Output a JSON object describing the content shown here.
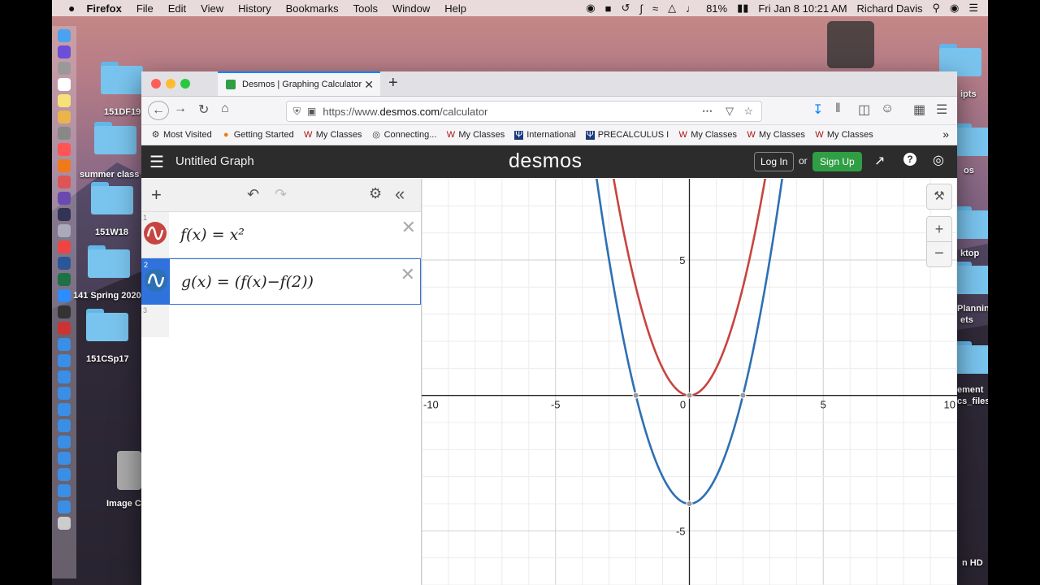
{
  "menubar": {
    "app": "Firefox",
    "items": [
      "File",
      "Edit",
      "View",
      "History",
      "Bookmarks",
      "Tools",
      "Window",
      "Help"
    ],
    "battery": "81%",
    "clock": "Fri Jan 8  10:21 AM",
    "user": "Richard Davis"
  },
  "desktop": {
    "labels": [
      "151DF19",
      "summer class",
      "151W18",
      "141 Spring 2020",
      "151CSp17",
      "Image C",
      "ipts",
      "os",
      "ktop",
      "Plannin",
      "ets",
      "ement",
      "cs_files",
      "n HD"
    ]
  },
  "browser": {
    "tab_title": "Desmos | Graphing Calculator",
    "url_prefix": "https://www.",
    "url_domain": "desmos.com",
    "url_path": "/calculator",
    "bookmarks": [
      "Most Visited",
      "Getting Started",
      "My Classes",
      "Connecting...",
      "My Classes",
      "International",
      "PRECALCULUS I",
      "My Classes",
      "My Classes",
      "My Classes"
    ]
  },
  "desmos": {
    "graph_title": "Untitled Graph",
    "logo": "desmos",
    "login": "Log In",
    "or": "or",
    "signup": "Sign Up",
    "expressions": [
      {
        "num": "1",
        "latex": "f(x) = x²",
        "color": "#c74440"
      },
      {
        "num": "2",
        "latex": "g(x) = (f(x)−f(2))",
        "color": "#2d70b3"
      },
      {
        "num": "3",
        "latex": ""
      }
    ]
  },
  "chart_data": {
    "type": "line",
    "xlim": [
      -10,
      10
    ],
    "ylim": [
      -7,
      8
    ],
    "x_ticks": [
      "-10",
      "-5",
      "0",
      "5",
      "10"
    ],
    "y_ticks": [
      "5",
      "-5"
    ],
    "grid": true,
    "series": [
      {
        "formula": "y = x^2",
        "color": "#c74440"
      },
      {
        "formula": "y = x^2 - 4",
        "color": "#2d70b3"
      }
    ],
    "points": [
      {
        "x": 0,
        "y": 0
      },
      {
        "x": -2,
        "y": 0
      },
      {
        "x": 2,
        "y": 0
      },
      {
        "x": 0,
        "y": -4
      }
    ]
  }
}
